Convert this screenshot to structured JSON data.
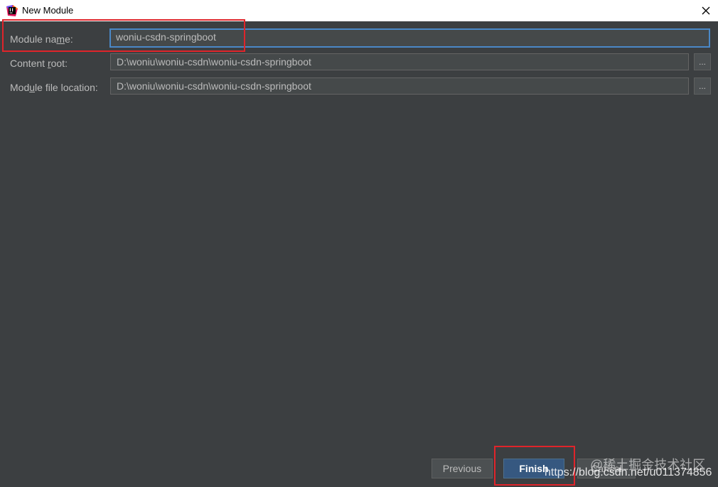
{
  "window": {
    "title": "New Module"
  },
  "form": {
    "module_name_label": "Module na",
    "module_name_label_u": "m",
    "module_name_label_end": "e:",
    "module_name_value": "woniu-csdn-springboot",
    "content_root_label": "Content ",
    "content_root_label_u": "r",
    "content_root_label_end": "oot:",
    "content_root_value": "D:\\woniu\\woniu-csdn\\woniu-csdn-springboot",
    "module_file_label": "Mod",
    "module_file_label_u": "u",
    "module_file_label_end": "le file location:",
    "module_file_value": "D:\\woniu\\woniu-csdn\\woniu-csdn-springboot",
    "browse_label": "..."
  },
  "buttons": {
    "previous": "Previous",
    "finish": "Finish",
    "cancel": "Cancel"
  },
  "watermark": {
    "line1": "@稀土掘金技术社区",
    "line2": "https://blog.csdn.net/u011374856"
  },
  "colors": {
    "background": "#3c3f41",
    "accent": "#4a88c7",
    "highlight": "#e0242a",
    "finish_bg": "#365880"
  },
  "icons": {
    "app": "intellij-idea-icon",
    "close": "close-icon"
  }
}
